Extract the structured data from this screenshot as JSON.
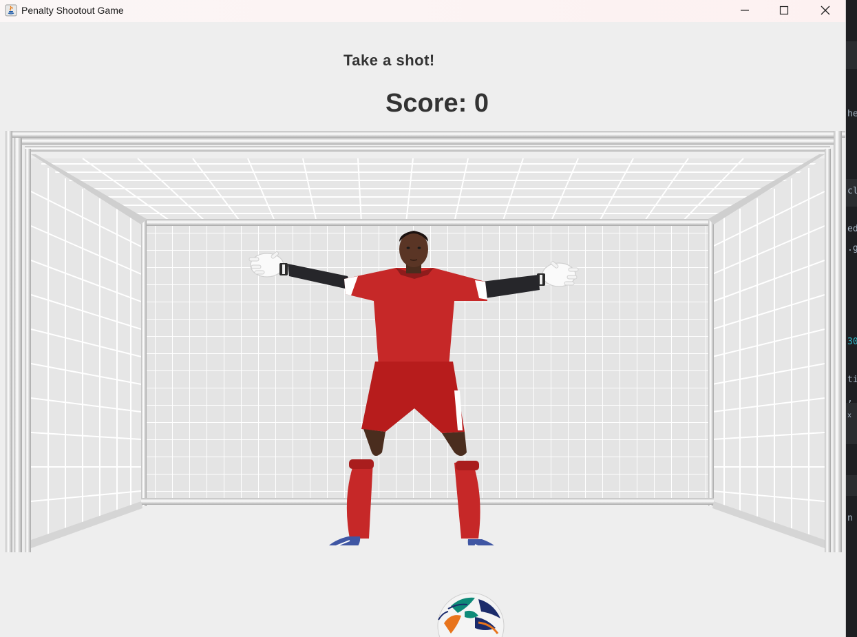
{
  "window": {
    "title": "Penalty Shootout Game",
    "controls": [
      "minimize",
      "maximize",
      "close"
    ]
  },
  "game": {
    "message": "Take a shot!",
    "score_label": "Score: 0",
    "score": 0
  },
  "scene": {
    "goal_icon": "goal-net",
    "goalkeeper_icon": "goalkeeper",
    "ball_icon": "soccer-ball",
    "kit_color": "#c62828",
    "background_color": "#eeeeee"
  },
  "background_editor_fragments": [
    "he",
    "cl",
    "ed",
    ".g",
    "30",
    "ti",
    ",",
    "x",
    "n"
  ]
}
